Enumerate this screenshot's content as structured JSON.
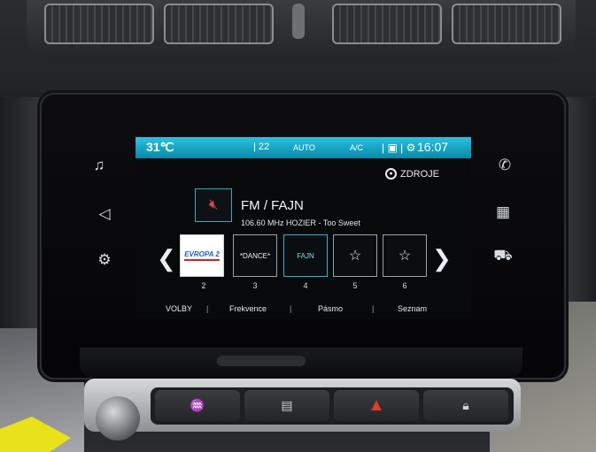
{
  "status_bar": {
    "temperature": "31℃",
    "fan": "| 22",
    "mode": "AUTO",
    "ac": "A/C",
    "icons": "| ▣ | ⚙",
    "clock": "16:07"
  },
  "sources_button": {
    "label": "ZDROJE",
    "icon": "radio-waves-icon"
  },
  "now_playing": {
    "title": "FM / FAJN",
    "info": "106.60 MHz HOZIER - Too Sweet",
    "mute_icon": "speaker-muted-icon"
  },
  "presets": [
    {
      "label": "EVROPA 2",
      "number": "2",
      "kind": "logo"
    },
    {
      "label": "*DANCE*",
      "number": "3",
      "kind": "text"
    },
    {
      "label": "FAJN",
      "number": "4",
      "kind": "active"
    },
    {
      "label": "",
      "number": "5",
      "kind": "favorite-add-icon"
    },
    {
      "label": "",
      "number": "6",
      "kind": "favorite-add-icon"
    }
  ],
  "bottom_bar": {
    "volby": "VOLBY",
    "frekvence": "Frekvence",
    "pasmo": "Pásmo",
    "seznam": "Seznam",
    "separator": "|"
  },
  "side_icons": {
    "left": [
      "music-note-icon",
      "navigation-icon",
      "car-settings-icon"
    ],
    "right": [
      "phone-icon",
      "apps-grid-icon",
      "car-icon"
    ]
  },
  "colors": {
    "status_bar": "#1aa6c8",
    "accent": "#2ab7d8",
    "mute": "#d84c4c",
    "hazard": "#e03a30"
  }
}
